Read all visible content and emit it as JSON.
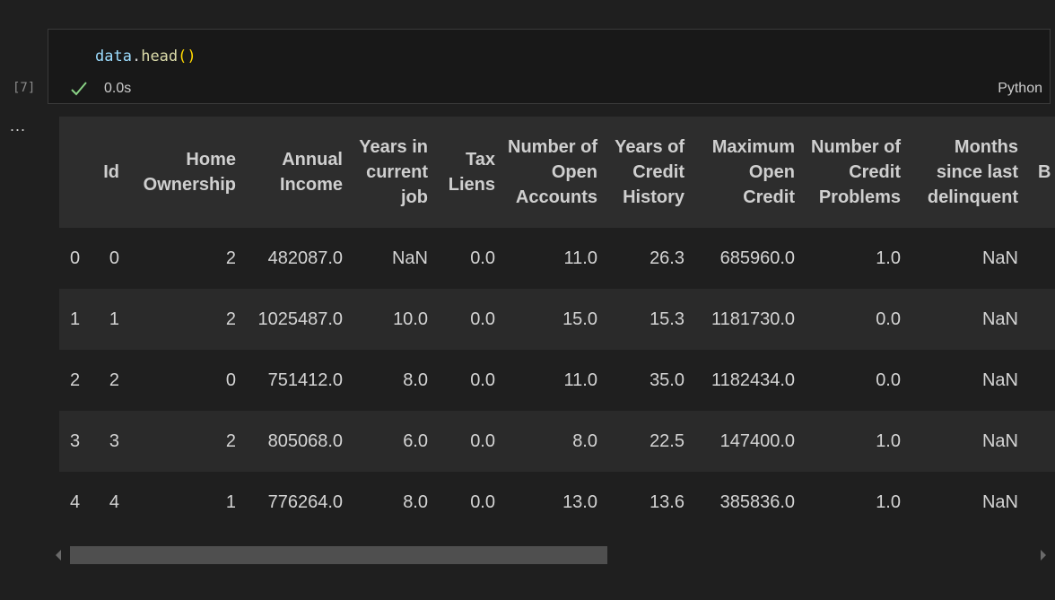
{
  "cell": {
    "code_obj": "data",
    "code_dot": ".",
    "code_method": "head",
    "code_parens": "()",
    "exec_count": "[7]",
    "duration": "0.0s",
    "language": "Python",
    "status_icon": "check-icon",
    "more_label": "..."
  },
  "table": {
    "columns": [
      "",
      "Id",
      "Home Ownership",
      "Annual Income",
      "Years in current job",
      "Tax Liens",
      "Number of Open Accounts",
      "Years of Credit History",
      "Maximum Open Credit",
      "Number of Credit Problems",
      "Months since last delinquent",
      "B"
    ],
    "rows": [
      [
        "0",
        "0",
        "2",
        "482087.0",
        "NaN",
        "0.0",
        "11.0",
        "26.3",
        "685960.0",
        "1.0",
        "NaN",
        ""
      ],
      [
        "1",
        "1",
        "2",
        "1025487.0",
        "10.0",
        "0.0",
        "15.0",
        "15.3",
        "1181730.0",
        "0.0",
        "NaN",
        ""
      ],
      [
        "2",
        "2",
        "0",
        "751412.0",
        "8.0",
        "0.0",
        "11.0",
        "35.0",
        "1182434.0",
        "0.0",
        "NaN",
        ""
      ],
      [
        "3",
        "3",
        "2",
        "805068.0",
        "6.0",
        "0.0",
        "8.0",
        "22.5",
        "147400.0",
        "1.0",
        "NaN",
        ""
      ],
      [
        "4",
        "4",
        "1",
        "776264.0",
        "8.0",
        "0.0",
        "13.0",
        "13.6",
        "385836.0",
        "1.0",
        "NaN",
        ""
      ]
    ]
  },
  "scroll": {
    "horizontal_position": 0.0,
    "visible_fraction": 0.54
  },
  "colors": {
    "background": "#1f1f1f",
    "header_bg": "#2d2d2d",
    "check": "#89d185",
    "code_var": "#9cdcfe",
    "code_method": "#dcdcaa",
    "code_paren": "#ffd700"
  }
}
